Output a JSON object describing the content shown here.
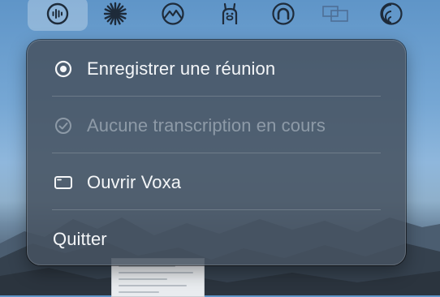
{
  "menubar": {
    "icons": [
      {
        "name": "waveform-record-icon",
        "active": true
      },
      {
        "name": "sparkle-burst-icon"
      },
      {
        "name": "mountain-peaks-icon"
      },
      {
        "name": "llama-icon"
      },
      {
        "name": "headphones-arc-icon"
      },
      {
        "name": "window-switcher-icon"
      },
      {
        "name": "swirl-logo-icon"
      }
    ]
  },
  "menu": {
    "items": [
      {
        "label": "Enregistrer une réunion",
        "icon": "record-circle-icon",
        "enabled": true
      },
      {
        "label": "Aucune transcription en cours",
        "icon": "check-circle-icon",
        "enabled": false
      },
      {
        "label": "Ouvrir Voxa",
        "icon": "window-icon",
        "enabled": true
      },
      {
        "label": "Quitter",
        "enabled": true
      }
    ]
  },
  "colors": {
    "menu_background": "#465260",
    "text": "#f4f6f8",
    "text_disabled": "#8e979f"
  }
}
